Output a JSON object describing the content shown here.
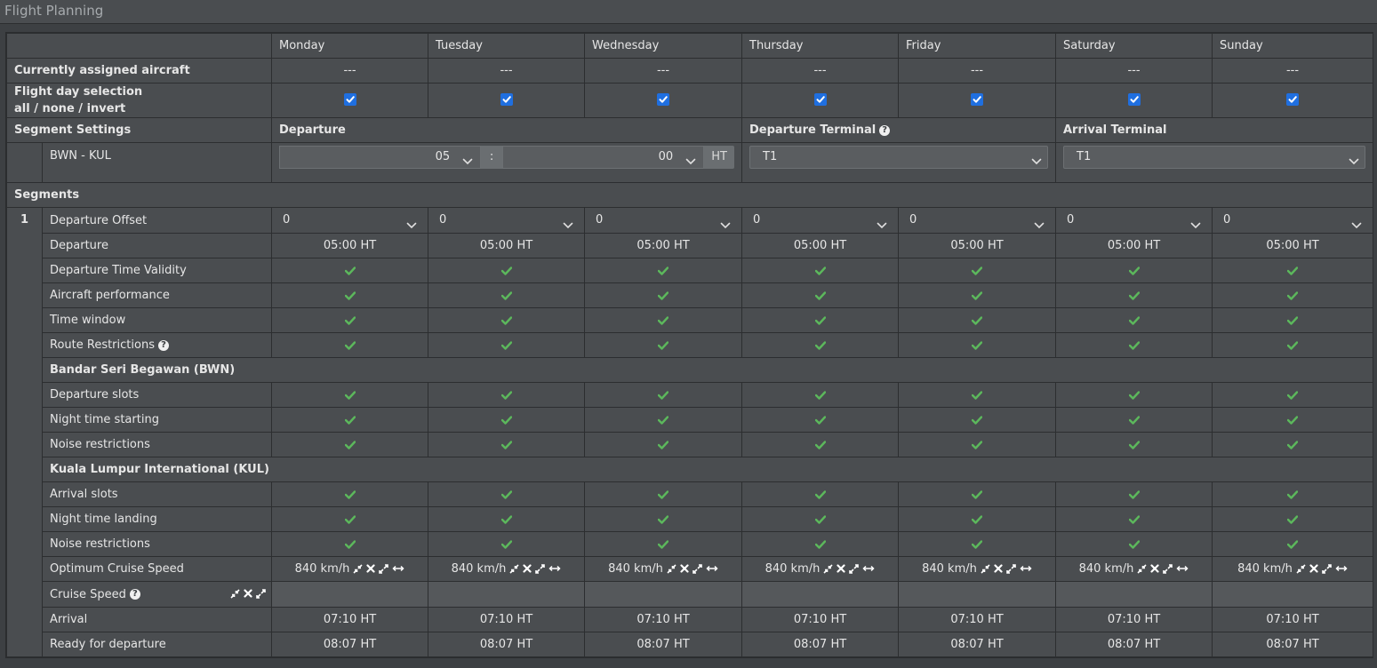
{
  "window": {
    "title": "Flight Planning"
  },
  "days": [
    "Monday",
    "Tuesday",
    "Wednesday",
    "Thursday",
    "Friday",
    "Saturday",
    "Sunday"
  ],
  "rows": {
    "assigned_aircraft_label": "Currently assigned aircraft",
    "assigned_aircraft_values": [
      "---",
      "---",
      "---",
      "---",
      "---",
      "---",
      "---"
    ],
    "flight_day_label": "Flight day selection",
    "flight_day_links": {
      "all": "all",
      "none": "none",
      "invert": "invert",
      "sep": " / "
    },
    "flight_day_checked": [
      true,
      true,
      true,
      true,
      true,
      true,
      true
    ]
  },
  "segment_settings": {
    "label": "Segment Settings",
    "departure_label": "Departure",
    "departure_terminal_label": "Departure Terminal",
    "arrival_terminal_label": "Arrival Terminal",
    "route": "BWN - KUL",
    "departure_hour": "05",
    "departure_minute": "00",
    "time_separator": ":",
    "timezone": "HT",
    "departure_terminal": "T1",
    "arrival_terminal": "T1"
  },
  "segments": {
    "label": "Segments",
    "number": "1",
    "departure_offset_label": "Departure Offset",
    "departure_offset_values": [
      "0",
      "0",
      "0",
      "0",
      "0",
      "0",
      "0"
    ],
    "departure_label": "Departure",
    "departure_values": [
      "05:00 HT",
      "05:00 HT",
      "05:00 HT",
      "05:00 HT",
      "05:00 HT",
      "05:00 HT",
      "05:00 HT"
    ],
    "checks_general": [
      {
        "label": "Departure Time Validity"
      },
      {
        "label": "Aircraft performance"
      },
      {
        "label": "Time window"
      },
      {
        "label": "Route Restrictions",
        "help": true
      }
    ],
    "origin_airport": "Bandar Seri Begawan (BWN)",
    "checks_origin": [
      {
        "label": "Departure slots"
      },
      {
        "label": "Night time starting"
      },
      {
        "label": "Noise restrictions"
      }
    ],
    "destination_airport": "Kuala Lumpur International (KUL)",
    "checks_destination": [
      {
        "label": "Arrival slots"
      },
      {
        "label": "Night time landing"
      },
      {
        "label": "Noise restrictions"
      }
    ],
    "optimum_speed_label": "Optimum Cruise Speed",
    "optimum_speed_values": [
      "840 km/h",
      "840 km/h",
      "840 km/h",
      "840 km/h",
      "840 km/h",
      "840 km/h",
      "840 km/h"
    ],
    "cruise_speed_label": "Cruise Speed",
    "arrival_label": "Arrival",
    "arrival_values": [
      "07:10 HT",
      "07:10 HT",
      "07:10 HT",
      "07:10 HT",
      "07:10 HT",
      "07:10 HT",
      "07:10 HT"
    ],
    "ready_label": "Ready for departure",
    "ready_values": [
      "08:07 HT",
      "08:07 HT",
      "08:07 HT",
      "08:07 HT",
      "08:07 HT",
      "08:07 HT",
      "08:07 HT"
    ]
  },
  "icons": {
    "check": "check-icon",
    "help": "question-circle-icon",
    "chevron": "chevron-down-icon",
    "compress": "compress-icon",
    "reset": "x-icon",
    "expand": "expand-icon",
    "apply_all": "arrows-horizontal-icon"
  },
  "colors": {
    "background": "#3d4043",
    "cell": "#4a4d50",
    "check_green": "#5cb85c",
    "checkbox_blue": "#1f6fe0"
  }
}
